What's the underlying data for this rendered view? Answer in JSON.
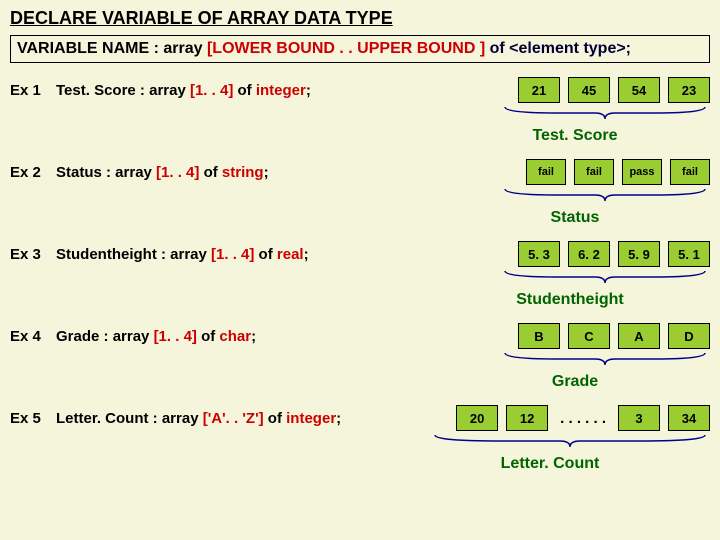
{
  "title": "DECLARE VARIABLE OF ARRAY DATA TYPE",
  "syntax": {
    "varname": "VARIABLE NAME",
    "colon": " : ",
    "array_kw": "array ",
    "bounds": "[LOWER BOUND . . UPPER BOUND ]",
    "of_elem": " of <element type>;"
  },
  "ex1": {
    "label": "Ex 1",
    "name": "Test. Score",
    "prefix": " : array ",
    "bounds": "[1. . 4]",
    "of": " of ",
    "type": "integer",
    "semi": ";",
    "cells": [
      "21",
      "45",
      "54",
      "23"
    ],
    "caption": "Test. Score"
  },
  "ex2": {
    "label": "Ex 2",
    "name": "Status",
    "prefix": " : array ",
    "bounds": "[1. . 4]",
    "of": " of ",
    "type": "string",
    "semi": ";",
    "cells": [
      "fail",
      "fail",
      "pass",
      "fail"
    ],
    "caption": "Status"
  },
  "ex3": {
    "label": "Ex 3",
    "name": "Studentheight",
    "prefix": " : array ",
    "bounds": "[1. . 4]",
    "of": " of ",
    "type": "real",
    "semi": ";",
    "cells": [
      "5. 3",
      "6. 2",
      "5. 9",
      "5. 1"
    ],
    "caption": "Studentheight"
  },
  "ex4": {
    "label": "Ex 4",
    "name": "Grade",
    "prefix": " : array ",
    "bounds": "[1. . 4]",
    "of": " of ",
    "type": "char",
    "semi": ";",
    "cells": [
      "B",
      "C",
      "A",
      "D"
    ],
    "caption": "Grade"
  },
  "ex5": {
    "label": "Ex 5",
    "name": "Letter. Count",
    "prefix": " : array ",
    "bounds": "['A'. . 'Z']",
    "of": " of ",
    "type": "integer",
    "semi": ";",
    "cells": [
      "20",
      "12"
    ],
    "dots": ". . . .  . .",
    "cells2": [
      "3",
      "34"
    ],
    "caption": "Letter. Count"
  }
}
